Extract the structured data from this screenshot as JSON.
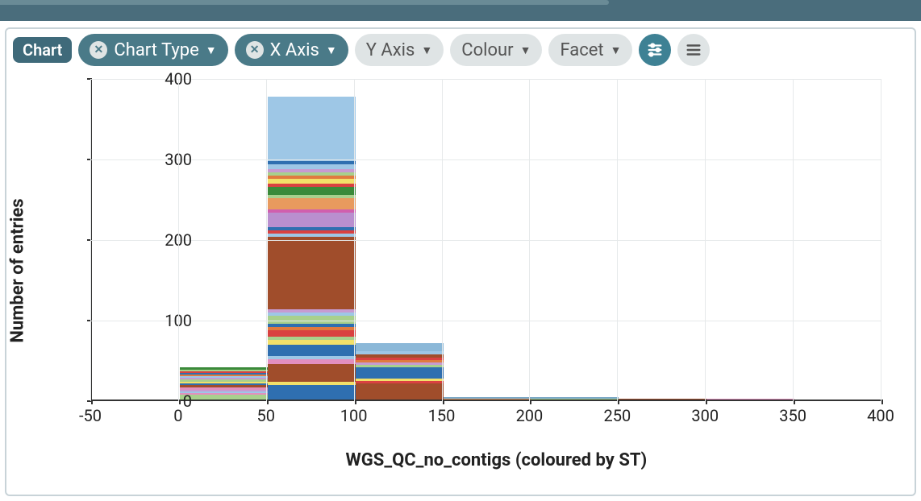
{
  "header": {
    "tag_label": "Chart"
  },
  "toolbar": {
    "chart_type": "Chart Type",
    "x_axis": "X Axis",
    "y_axis": "Y Axis",
    "colour": "Colour",
    "facet": "Facet"
  },
  "chart_data": {
    "type": "bar",
    "title": "",
    "xlabel": "WGS_QC_no_contigs (coloured by ST)",
    "ylabel": "Number of entries",
    "xlim": [
      -50,
      400
    ],
    "ylim": [
      0,
      400
    ],
    "xticks": [
      -50,
      0,
      50,
      100,
      150,
      200,
      250,
      300,
      350,
      400
    ],
    "yticks": [
      0,
      100,
      200,
      300,
      400
    ],
    "bin_width": 50,
    "bars": [
      {
        "x_start": 0,
        "x_end": 50,
        "total": 40,
        "segments": [
          {
            "h": 6,
            "c": "#a8d08d"
          },
          {
            "h": 2,
            "c": "#e28fbf"
          },
          {
            "h": 2,
            "c": "#9ec7e6"
          },
          {
            "h": 2,
            "c": "#c79bd1"
          },
          {
            "h": 3,
            "c": "#e28fbf"
          },
          {
            "h": 3,
            "c": "#a04d2b"
          },
          {
            "h": 2,
            "c": "#2f6fb0"
          },
          {
            "h": 2,
            "c": "#f2e06a"
          },
          {
            "h": 3,
            "c": "#a8d08d"
          },
          {
            "h": 2,
            "c": "#c79bd1"
          },
          {
            "h": 2,
            "c": "#9ec7e6"
          },
          {
            "h": 2,
            "c": "#e07b3f"
          },
          {
            "h": 2,
            "c": "#2f6fb0"
          },
          {
            "h": 2,
            "c": "#d94141"
          },
          {
            "h": 2,
            "c": "#a8d08d"
          },
          {
            "h": 3,
            "c": "#3a8a3a"
          }
        ]
      },
      {
        "x_start": 50,
        "x_end": 100,
        "total": 380,
        "segments": [
          {
            "h": 18,
            "c": "#2f6fb0"
          },
          {
            "h": 4,
            "c": "#f2e06a"
          },
          {
            "h": 22,
            "c": "#a04d2b"
          },
          {
            "h": 6,
            "c": "#e28fbf"
          },
          {
            "h": 4,
            "c": "#9ec7e6"
          },
          {
            "h": 14,
            "c": "#2f6fb0"
          },
          {
            "h": 6,
            "c": "#f2e06a"
          },
          {
            "h": 4,
            "c": "#a8d08d"
          },
          {
            "h": 8,
            "c": "#d94141"
          },
          {
            "h": 4,
            "c": "#e07b3f"
          },
          {
            "h": 4,
            "c": "#2f6fb0"
          },
          {
            "h": 10,
            "c": "#a8d08d"
          },
          {
            "h": 4,
            "c": "#9ec7e6"
          },
          {
            "h": 4,
            "c": "#c79bd1"
          },
          {
            "h": 90,
            "c": "#a04d2b"
          },
          {
            "h": 4,
            "c": "#9ec7e6"
          },
          {
            "h": 4,
            "c": "#d94141"
          },
          {
            "h": 4,
            "c": "#2f6fb0"
          },
          {
            "h": 18,
            "c": "#b98fcf"
          },
          {
            "h": 4,
            "c": "#d05fae"
          },
          {
            "h": 14,
            "c": "#e89a5e"
          },
          {
            "h": 4,
            "c": "#a8d08d"
          },
          {
            "h": 10,
            "c": "#3a8a3a"
          },
          {
            "h": 4,
            "c": "#d94141"
          },
          {
            "h": 6,
            "c": "#f2e06a"
          },
          {
            "h": 4,
            "c": "#e07b3f"
          },
          {
            "h": 4,
            "c": "#a8d08d"
          },
          {
            "h": 4,
            "c": "#c79bd1"
          },
          {
            "h": 6,
            "c": "#9ec7e6"
          },
          {
            "h": 4,
            "c": "#2f6fb0"
          },
          {
            "h": 80,
            "c": "#9ec7e6"
          }
        ]
      },
      {
        "x_start": 100,
        "x_end": 150,
        "total": 70,
        "segments": [
          {
            "h": 20,
            "c": "#a04d2b"
          },
          {
            "h": 3,
            "c": "#d94141"
          },
          {
            "h": 3,
            "c": "#f2e06a"
          },
          {
            "h": 14,
            "c": "#2f6fb0"
          },
          {
            "h": 3,
            "c": "#a8d08d"
          },
          {
            "h": 3,
            "c": "#c79bd1"
          },
          {
            "h": 3,
            "c": "#e07b3f"
          },
          {
            "h": 3,
            "c": "#d94141"
          },
          {
            "h": 4,
            "c": "#a04d2b"
          },
          {
            "h": 4,
            "c": "#9ec7e6"
          },
          {
            "h": 10,
            "c": "#8bb8d8"
          }
        ]
      },
      {
        "x_start": 150,
        "x_end": 200,
        "total": 3,
        "segments": [
          {
            "h": 1.5,
            "c": "#e89a5e"
          },
          {
            "h": 1.5,
            "c": "#7aa8c7"
          }
        ]
      },
      {
        "x_start": 200,
        "x_end": 250,
        "total": 3,
        "segments": [
          {
            "h": 1.5,
            "c": "#a8d08d"
          },
          {
            "h": 1.5,
            "c": "#7aa8c7"
          }
        ]
      },
      {
        "x_start": 250,
        "x_end": 300,
        "total": 1,
        "segments": [
          {
            "h": 1,
            "c": "#a04d2b"
          }
        ]
      },
      {
        "x_start": 300,
        "x_end": 350,
        "total": 1,
        "segments": [
          {
            "h": 1,
            "c": "#e28fbf"
          }
        ]
      }
    ]
  }
}
